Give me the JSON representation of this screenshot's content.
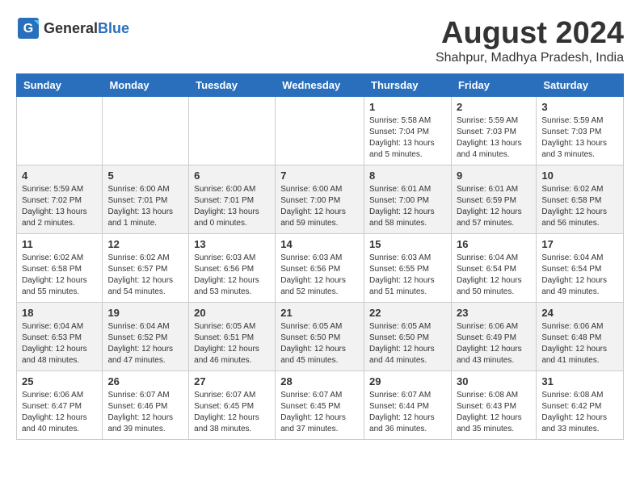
{
  "header": {
    "logo_general": "General",
    "logo_blue": "Blue",
    "month_year": "August 2024",
    "location": "Shahpur, Madhya Pradesh, India"
  },
  "days_of_week": [
    "Sunday",
    "Monday",
    "Tuesday",
    "Wednesday",
    "Thursday",
    "Friday",
    "Saturday"
  ],
  "weeks": [
    [
      {
        "day": "",
        "info": ""
      },
      {
        "day": "",
        "info": ""
      },
      {
        "day": "",
        "info": ""
      },
      {
        "day": "",
        "info": ""
      },
      {
        "day": "1",
        "info": "Sunrise: 5:58 AM\nSunset: 7:04 PM\nDaylight: 13 hours\nand 5 minutes."
      },
      {
        "day": "2",
        "info": "Sunrise: 5:59 AM\nSunset: 7:03 PM\nDaylight: 13 hours\nand 4 minutes."
      },
      {
        "day": "3",
        "info": "Sunrise: 5:59 AM\nSunset: 7:03 PM\nDaylight: 13 hours\nand 3 minutes."
      }
    ],
    [
      {
        "day": "4",
        "info": "Sunrise: 5:59 AM\nSunset: 7:02 PM\nDaylight: 13 hours\nand 2 minutes."
      },
      {
        "day": "5",
        "info": "Sunrise: 6:00 AM\nSunset: 7:01 PM\nDaylight: 13 hours\nand 1 minute."
      },
      {
        "day": "6",
        "info": "Sunrise: 6:00 AM\nSunset: 7:01 PM\nDaylight: 13 hours\nand 0 minutes."
      },
      {
        "day": "7",
        "info": "Sunrise: 6:00 AM\nSunset: 7:00 PM\nDaylight: 12 hours\nand 59 minutes."
      },
      {
        "day": "8",
        "info": "Sunrise: 6:01 AM\nSunset: 7:00 PM\nDaylight: 12 hours\nand 58 minutes."
      },
      {
        "day": "9",
        "info": "Sunrise: 6:01 AM\nSunset: 6:59 PM\nDaylight: 12 hours\nand 57 minutes."
      },
      {
        "day": "10",
        "info": "Sunrise: 6:02 AM\nSunset: 6:58 PM\nDaylight: 12 hours\nand 56 minutes."
      }
    ],
    [
      {
        "day": "11",
        "info": "Sunrise: 6:02 AM\nSunset: 6:58 PM\nDaylight: 12 hours\nand 55 minutes."
      },
      {
        "day": "12",
        "info": "Sunrise: 6:02 AM\nSunset: 6:57 PM\nDaylight: 12 hours\nand 54 minutes."
      },
      {
        "day": "13",
        "info": "Sunrise: 6:03 AM\nSunset: 6:56 PM\nDaylight: 12 hours\nand 53 minutes."
      },
      {
        "day": "14",
        "info": "Sunrise: 6:03 AM\nSunset: 6:56 PM\nDaylight: 12 hours\nand 52 minutes."
      },
      {
        "day": "15",
        "info": "Sunrise: 6:03 AM\nSunset: 6:55 PM\nDaylight: 12 hours\nand 51 minutes."
      },
      {
        "day": "16",
        "info": "Sunrise: 6:04 AM\nSunset: 6:54 PM\nDaylight: 12 hours\nand 50 minutes."
      },
      {
        "day": "17",
        "info": "Sunrise: 6:04 AM\nSunset: 6:54 PM\nDaylight: 12 hours\nand 49 minutes."
      }
    ],
    [
      {
        "day": "18",
        "info": "Sunrise: 6:04 AM\nSunset: 6:53 PM\nDaylight: 12 hours\nand 48 minutes."
      },
      {
        "day": "19",
        "info": "Sunrise: 6:04 AM\nSunset: 6:52 PM\nDaylight: 12 hours\nand 47 minutes."
      },
      {
        "day": "20",
        "info": "Sunrise: 6:05 AM\nSunset: 6:51 PM\nDaylight: 12 hours\nand 46 minutes."
      },
      {
        "day": "21",
        "info": "Sunrise: 6:05 AM\nSunset: 6:50 PM\nDaylight: 12 hours\nand 45 minutes."
      },
      {
        "day": "22",
        "info": "Sunrise: 6:05 AM\nSunset: 6:50 PM\nDaylight: 12 hours\nand 44 minutes."
      },
      {
        "day": "23",
        "info": "Sunrise: 6:06 AM\nSunset: 6:49 PM\nDaylight: 12 hours\nand 43 minutes."
      },
      {
        "day": "24",
        "info": "Sunrise: 6:06 AM\nSunset: 6:48 PM\nDaylight: 12 hours\nand 41 minutes."
      }
    ],
    [
      {
        "day": "25",
        "info": "Sunrise: 6:06 AM\nSunset: 6:47 PM\nDaylight: 12 hours\nand 40 minutes."
      },
      {
        "day": "26",
        "info": "Sunrise: 6:07 AM\nSunset: 6:46 PM\nDaylight: 12 hours\nand 39 minutes."
      },
      {
        "day": "27",
        "info": "Sunrise: 6:07 AM\nSunset: 6:45 PM\nDaylight: 12 hours\nand 38 minutes."
      },
      {
        "day": "28",
        "info": "Sunrise: 6:07 AM\nSunset: 6:45 PM\nDaylight: 12 hours\nand 37 minutes."
      },
      {
        "day": "29",
        "info": "Sunrise: 6:07 AM\nSunset: 6:44 PM\nDaylight: 12 hours\nand 36 minutes."
      },
      {
        "day": "30",
        "info": "Sunrise: 6:08 AM\nSunset: 6:43 PM\nDaylight: 12 hours\nand 35 minutes."
      },
      {
        "day": "31",
        "info": "Sunrise: 6:08 AM\nSunset: 6:42 PM\nDaylight: 12 hours\nand 33 minutes."
      }
    ]
  ]
}
